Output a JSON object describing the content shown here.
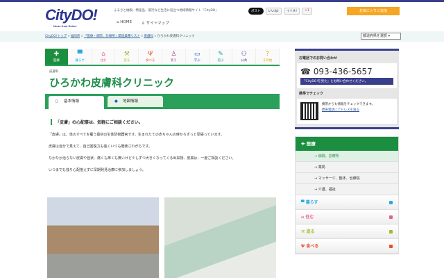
{
  "header": {
    "logo": "CityDO!",
    "logo_sub": "News from Sohee",
    "tagline": "ふるさと納税、特産品、旅行など生活に役立つ地域情報サイト『CityDO』",
    "nav": [
      "HOME",
      "サイトマップ"
    ],
    "social": [
      "ポスト",
      "いいね!",
      "イイネ!",
      "+1"
    ],
    "favorite": "お気に入りに追加"
  },
  "breadcrumb": [
    "CityDO!トップ",
    "福岡県",
    "「医療・病院、診療所」関連業種リスト",
    "皮膚科",
    "ひろかわ皮膚科クリニック"
  ],
  "pref_select": "都道府県を選択",
  "categories": [
    {
      "label": "医療",
      "icon": "✚"
    },
    {
      "label": "暮らす",
      "icon": "▀"
    },
    {
      "label": "住む",
      "icon": "⌂"
    },
    {
      "label": "造る",
      "icon": "⚒"
    },
    {
      "label": "食べる",
      "icon": "Ψ"
    },
    {
      "label": "装う",
      "icon": "♙"
    },
    {
      "label": "学ぶ",
      "icon": "▭"
    },
    {
      "label": "遊ぶ",
      "icon": "✎"
    },
    {
      "label": "公共",
      "icon": "⚇"
    },
    {
      "label": "その他",
      "icon": "?"
    }
  ],
  "main": {
    "subcategory": "皮膚科",
    "title": "ひろかわ皮膚科クリニック",
    "tabs": [
      "基本情報",
      "地図情報"
    ],
    "lead": "「皮膚」の心配事は、気軽にご相談ください。",
    "paragraphs": [
      "「皮膚」は、体のすべてを覆う最初の生体防御器官です。生まれたての赤ちゃんの時からずっと頑張っています。",
      "皮膚は自分で見えて、自己回復力も強くいつも酷使されがちです。",
      "なかなか治らない皮膚や症状、痛くも痒くも無いけど少しずつ大きくなってくる出来物、皮膚は、一度ご相談ください。",
      "いつまでも独り心配抱えずに早期発見治療に参加しましょう。"
    ]
  },
  "side": {
    "phone_heading": "お電話でのお問い合わせ",
    "phone": "☎ 093-436-5657",
    "phone_note": "「CityDO!を見た」とお問い合わせください。",
    "mobile_heading": "携帯でチェック",
    "mobile_text": "携帯からも情報をチェックできます。",
    "mobile_link": "携帯電話にアドレスを送る"
  },
  "menu": {
    "head": "医療",
    "subs": [
      "→ 病院、診療所",
      "→ 薬局",
      "→ マッサージ、整体、治療院",
      "→ 介護、福祉"
    ],
    "cats": [
      {
        "label": "暮らす",
        "color": "#29a8e0"
      },
      {
        "label": "住む",
        "color": "#e8608a"
      },
      {
        "label": "造る",
        "color": "#a8b82a"
      },
      {
        "label": "食べる",
        "color": "#e8502a"
      }
    ]
  }
}
